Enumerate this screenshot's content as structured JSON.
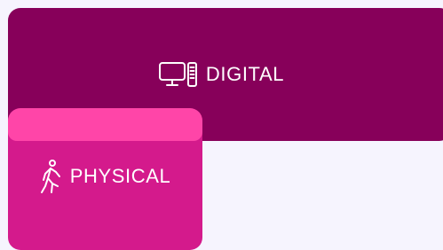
{
  "tiles": {
    "digital": {
      "label": "DIGITAL",
      "icon": "desktop-computer-icon",
      "background": "#87005a"
    },
    "physical": {
      "label": "PHYSICAL",
      "icon": "walking-person-icon",
      "background": "#d41a8c",
      "highlight": "#ff45a8"
    }
  },
  "page": {
    "background": "#f6f4fe"
  }
}
